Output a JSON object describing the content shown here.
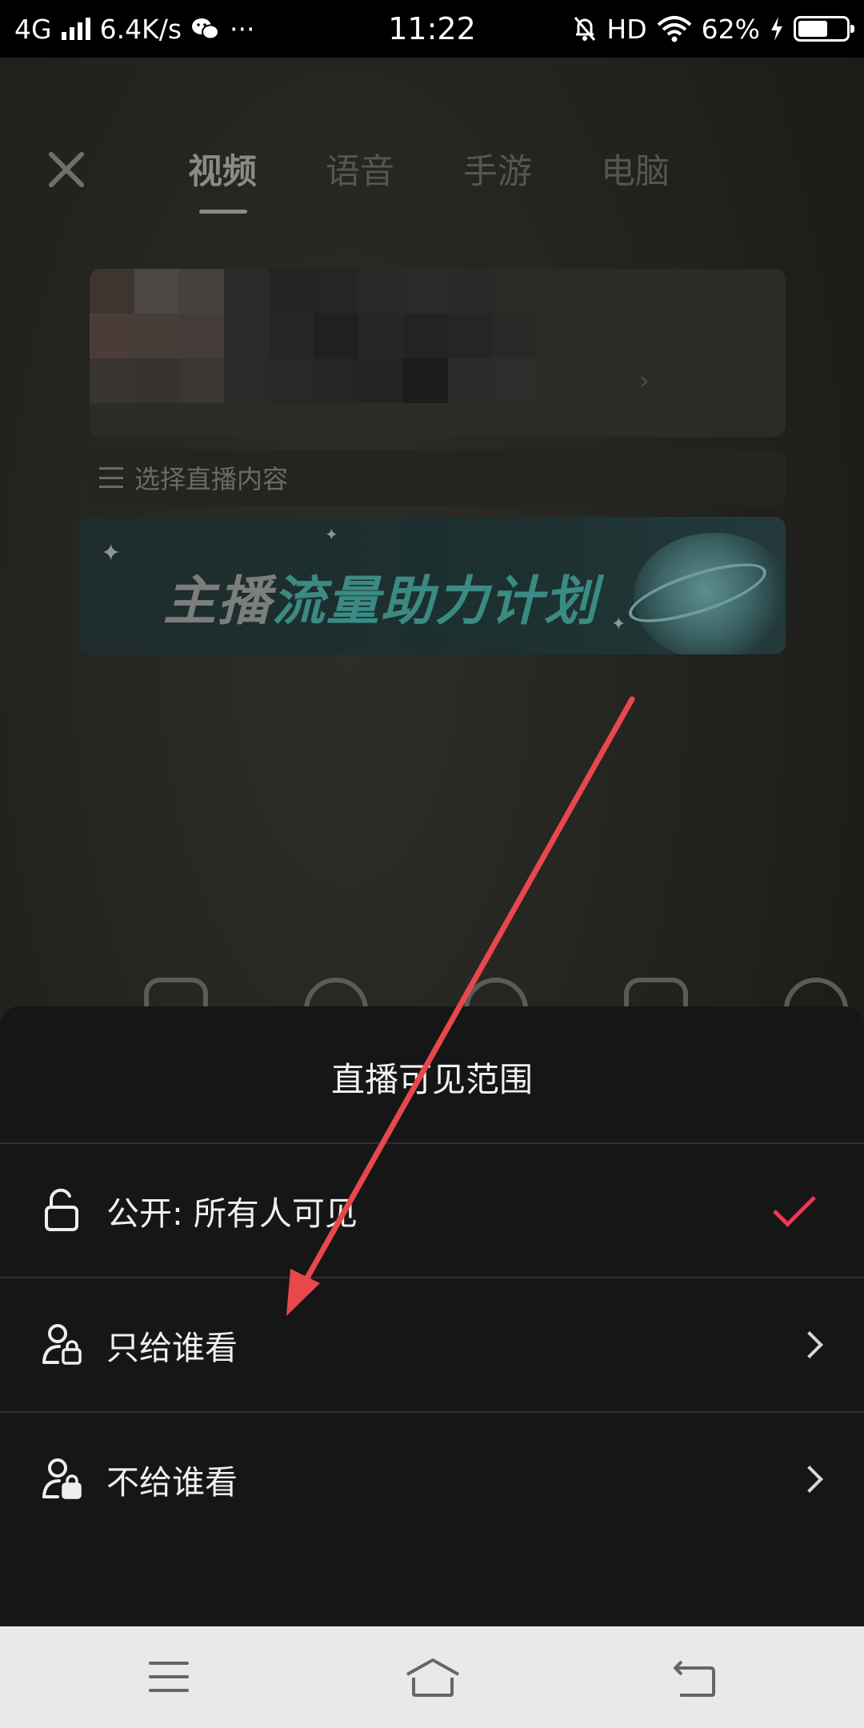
{
  "status_bar": {
    "network": "4G",
    "speed": "6.4K/s",
    "more": "···",
    "time": "11:22",
    "hd": "HD",
    "battery": "62%"
  },
  "background_page": {
    "tabs": [
      {
        "label": "视频",
        "active": true
      },
      {
        "label": "语音",
        "active": false
      },
      {
        "label": "手游",
        "active": false
      },
      {
        "label": "电脑",
        "active": false
      }
    ],
    "select_content_label": "选择直播内容",
    "banner": {
      "text_part1": "主播",
      "text_part2": "流量助力计划"
    }
  },
  "sheet": {
    "title": "直播可见范围",
    "options": [
      {
        "label": "公开: 所有人可见",
        "icon": "unlock-icon",
        "selected": true
      },
      {
        "label": "只给谁看",
        "icon": "user-lock-icon",
        "selected": false
      },
      {
        "label": "不给谁看",
        "icon": "user-lock-icon",
        "selected": false
      }
    ]
  },
  "colors": {
    "accent_check": "#f13557",
    "annotation_arrow": "#e8474c",
    "sheet_bg": "#161616"
  }
}
